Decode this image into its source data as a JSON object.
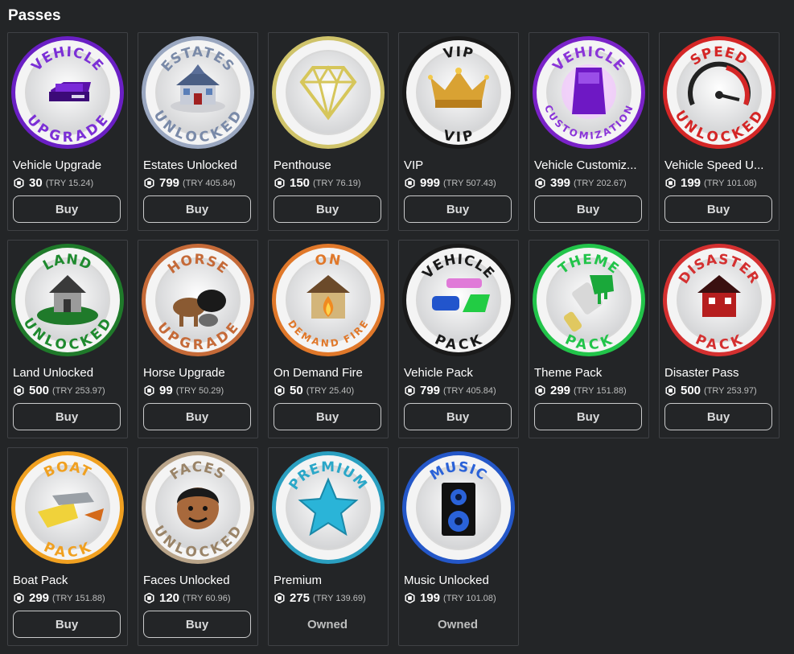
{
  "section": {
    "title": "Passes"
  },
  "currency_icon": "robux-icon",
  "passes": [
    {
      "name": "Vehicle Upgrade",
      "price": "30",
      "local_price": "(TRY 15.24)",
      "action": "Buy",
      "owned": false,
      "badge": {
        "top": "VEHICLE",
        "bottom": "UPGRADE",
        "ring": "#6a1fc4",
        "text": "#7b2fd6",
        "icon": "purple-car-icon"
      }
    },
    {
      "name": "Estates Unlocked",
      "price": "799",
      "local_price": "(TRY 405.84)",
      "action": "Buy",
      "owned": false,
      "badge": {
        "top": "ESTATES",
        "bottom": "UNLOCKED",
        "ring": "#9aa7c0",
        "text": "#7a8aa8",
        "icon": "mansion-icon"
      }
    },
    {
      "name": "Penthouse",
      "price": "150",
      "local_price": "(TRY 76.19)",
      "action": "Buy",
      "owned": false,
      "badge": {
        "top": "",
        "bottom": "",
        "ring": "#cfc36a",
        "text": "#cfc36a",
        "icon": "diamond-icon"
      }
    },
    {
      "name": "VIP",
      "price": "999",
      "local_price": "(TRY 507.43)",
      "action": "Buy",
      "owned": false,
      "badge": {
        "top": "VIP",
        "bottom": "VIP",
        "ring": "#1a1a1a",
        "text": "#1a1a1a",
        "icon": "crown-icon"
      }
    },
    {
      "name": "Vehicle Customiz...",
      "price": "399",
      "local_price": "(TRY 202.67)",
      "action": "Buy",
      "owned": false,
      "badge": {
        "top": "VEHICLE",
        "bottom": "CUSTOMIZATION",
        "ring": "#7a22c8",
        "text": "#8a34d8",
        "icon": "purple-van-icon"
      }
    },
    {
      "name": "Vehicle Speed U...",
      "price": "199",
      "local_price": "(TRY 101.08)",
      "action": "Buy",
      "owned": false,
      "badge": {
        "top": "SPEED",
        "bottom": "UNLOCKED",
        "ring": "#d42626",
        "text": "#d42626",
        "icon": "speedometer-icon"
      }
    },
    {
      "name": "Land Unlocked",
      "price": "500",
      "local_price": "(TRY 253.97)",
      "action": "Buy",
      "owned": false,
      "badge": {
        "top": "LAND",
        "bottom": "UNLOCKED",
        "ring": "#1f7a2a",
        "text": "#1f8a2f",
        "icon": "house-on-land-icon"
      }
    },
    {
      "name": "Horse Upgrade",
      "price": "99",
      "local_price": "(TRY 50.29)",
      "action": "Buy",
      "owned": false,
      "badge": {
        "top": "HORSE",
        "bottom": "UPGRADE",
        "ring": "#c56a38",
        "text": "#c56a38",
        "icon": "horses-icon"
      }
    },
    {
      "name": "On Demand Fire",
      "price": "50",
      "local_price": "(TRY 25.40)",
      "action": "Buy",
      "owned": false,
      "badge": {
        "top": "ON",
        "bottom": "DEMAND FIRE",
        "ring": "#e0782a",
        "text": "#e0782a",
        "icon": "burning-house-icon"
      }
    },
    {
      "name": "Vehicle Pack",
      "price": "799",
      "local_price": "(TRY 405.84)",
      "action": "Buy",
      "owned": false,
      "badge": {
        "top": "VEHICLE",
        "bottom": "PACK",
        "ring": "#1a1a1a",
        "text": "#1a1a1a",
        "icon": "cars-icon"
      }
    },
    {
      "name": "Theme Pack",
      "price": "299",
      "local_price": "(TRY 151.88)",
      "action": "Buy",
      "owned": false,
      "badge": {
        "top": "THEME",
        "bottom": "PACK",
        "ring": "#22c44a",
        "text": "#22c44a",
        "icon": "paintbrush-icon"
      }
    },
    {
      "name": "Disaster Pass",
      "price": "500",
      "local_price": "(TRY 253.97)",
      "action": "Buy",
      "owned": false,
      "badge": {
        "top": "DISASTER",
        "bottom": "PACK",
        "ring": "#d43030",
        "text": "#d43030",
        "icon": "red-house-icon"
      }
    },
    {
      "name": "Boat Pack",
      "price": "299",
      "local_price": "(TRY 151.88)",
      "action": "Buy",
      "owned": false,
      "badge": {
        "top": "BOAT",
        "bottom": "PACK",
        "ring": "#f0a020",
        "text": "#f0a020",
        "icon": "boats-icon"
      }
    },
    {
      "name": "Faces Unlocked",
      "price": "120",
      "local_price": "(TRY 60.96)",
      "action": "Buy",
      "owned": false,
      "badge": {
        "top": "FACES",
        "bottom": "UNLOCKED",
        "ring": "#b9a489",
        "text": "#9a8468",
        "icon": "face-icon"
      }
    },
    {
      "name": "Premium",
      "price": "275",
      "local_price": "(TRY 139.69)",
      "action": "Owned",
      "owned": true,
      "badge": {
        "top": "PREMIUM",
        "bottom": "",
        "ring": "#2a9fc0",
        "text": "#2aa7c8",
        "icon": "star-icon"
      }
    },
    {
      "name": "Music Unlocked",
      "price": "199",
      "local_price": "(TRY 101.08)",
      "action": "Owned",
      "owned": true,
      "badge": {
        "top": "MUSIC",
        "bottom": "",
        "ring": "#2457c8",
        "text": "#2a62d8",
        "icon": "speaker-icon"
      }
    }
  ]
}
